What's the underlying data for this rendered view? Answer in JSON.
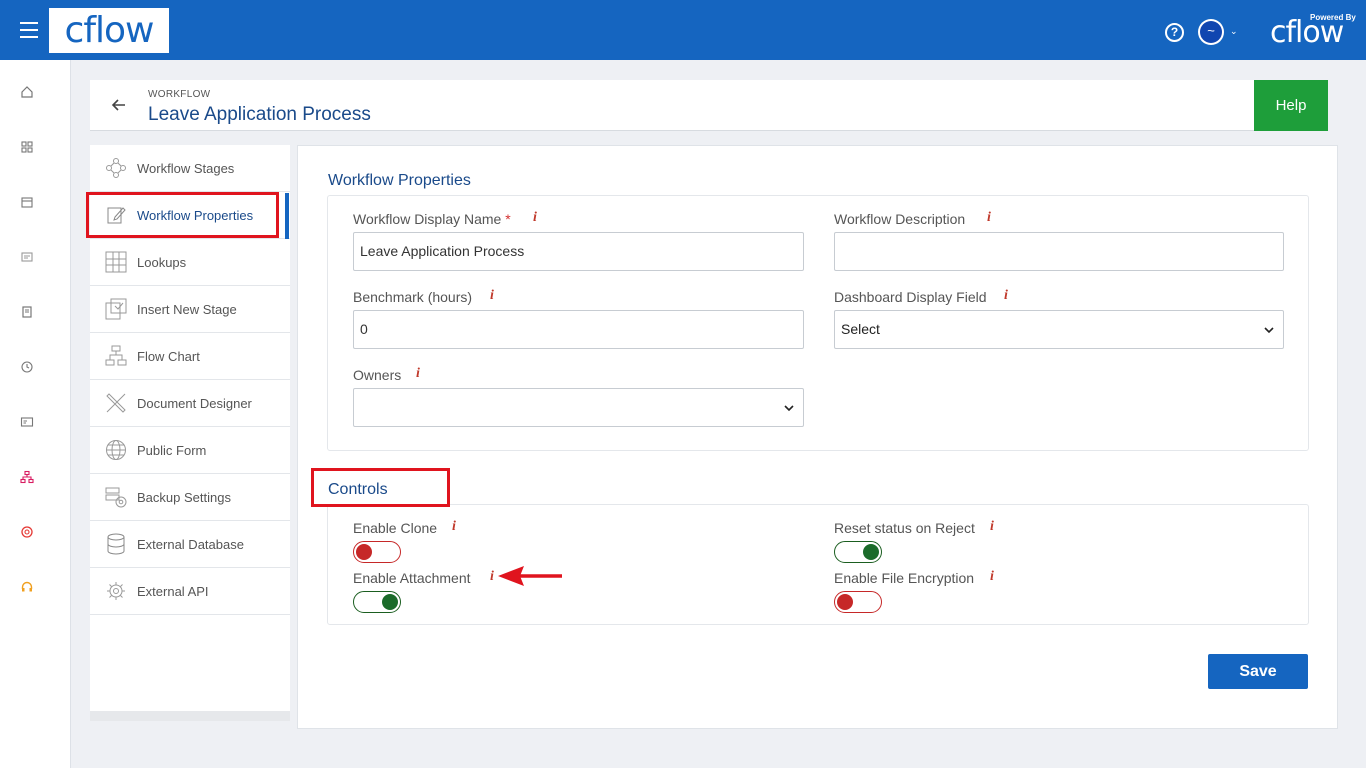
{
  "topbar": {
    "logo_text": "cflow",
    "help_glyph": "?",
    "avatar_glyph": "~",
    "avatar_chevron": "⌄",
    "powered_by": "Powered By",
    "powered_logo": "cflow"
  },
  "rail": {
    "icons": [
      "home-icon",
      "dashboard-icon",
      "calendar-icon",
      "reports-icon",
      "book-icon",
      "history-icon",
      "id-card-icon",
      "workflow-icon",
      "support-ring-icon",
      "headset-icon"
    ]
  },
  "header": {
    "breadcrumb": "WORKFLOW",
    "title": "Leave Application Process",
    "help_label": "Help"
  },
  "sidemenu": {
    "items": [
      {
        "label": "Workflow Stages",
        "icon": "stages-icon"
      },
      {
        "label": "Workflow Properties",
        "icon": "edit-properties-icon"
      },
      {
        "label": "Lookups",
        "icon": "grid-icon"
      },
      {
        "label": "Insert New Stage",
        "icon": "insert-stage-icon"
      },
      {
        "label": "Flow Chart",
        "icon": "flowchart-icon"
      },
      {
        "label": "Document Designer",
        "icon": "design-tools-icon"
      },
      {
        "label": "Public Form",
        "icon": "globe-icon"
      },
      {
        "label": "Backup Settings",
        "icon": "backup-icon"
      },
      {
        "label": "External Database",
        "icon": "database-icon"
      },
      {
        "label": "External API",
        "icon": "api-gear-icon"
      }
    ],
    "active_index": 1
  },
  "properties": {
    "section_title": "Workflow Properties",
    "display_name_label": "Workflow Display Name",
    "required_mark": "*",
    "display_name_value": "Leave Application Process",
    "description_label": "Workflow Description",
    "description_value": "",
    "benchmark_label": "Benchmark (hours)",
    "benchmark_value": "0",
    "dashboard_label": "Dashboard Display Field",
    "dashboard_value": "Select",
    "owners_label": "Owners",
    "owners_value": "",
    "info_glyph": "i"
  },
  "controls": {
    "section_title": "Controls",
    "enable_clone": {
      "label": "Enable Clone",
      "on": false
    },
    "reset_status": {
      "label": "Reset status on Reject",
      "on": true
    },
    "enable_attachment": {
      "label": "Enable Attachment",
      "on": true
    },
    "file_encryption": {
      "label": "Enable File Encryption",
      "on": false
    }
  },
  "actions": {
    "save_label": "Save"
  },
  "colors": {
    "topbar": "#1565c0",
    "help_button": "#1e9e3a",
    "highlight": "#e0141e",
    "toggle_on": "#1b6b2a",
    "toggle_off": "#c62828"
  }
}
